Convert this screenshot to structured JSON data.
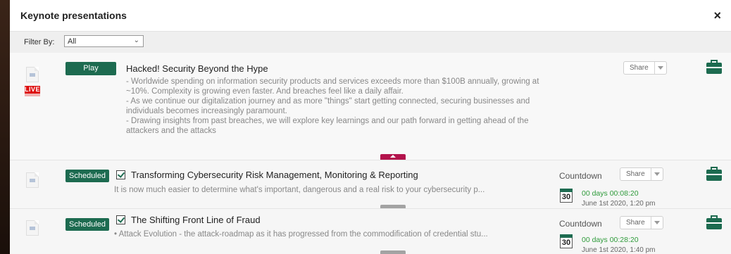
{
  "header": {
    "title": "Keynote presentations",
    "close_label": "×"
  },
  "filter": {
    "label": "Filter By:",
    "value": "All"
  },
  "rows": [
    {
      "status_label": "Play",
      "live_badge": "LIVE",
      "title": "Hacked! Security Beyond the Hype",
      "description": "- Worldwide spending on information security products and services exceeds more than $100B annually, growing at ~10%. Complexity is growing even faster. And breaches feel like a daily affair.\n- As we continue our digitalization journey and as more \"things\" start getting connected, securing businesses and individuals becomes increasingly paramount.\n- Drawing insights from past breaches, we will explore key learnings and our path forward in getting ahead of the attackers and the attacks",
      "share_label": "Share"
    },
    {
      "status_label": "Scheduled",
      "title": "Transforming Cybersecurity Risk Management, Monitoring & Reporting",
      "description": "It is now much easier to determine what's important, dangerous and a real risk to your cybersecurity p...",
      "share_label": "Share",
      "countdown_label": "Countdown",
      "calendar_day": "30",
      "days_text": "00 days",
      "time_text": "00:08:20",
      "date_text": "June 1st 2020, 1:20 pm"
    },
    {
      "status_label": "Scheduled",
      "title": "The Shifting Front Line of Fraud",
      "description": "• Attack Evolution - the attack-roadmap as it has progressed from the commodification of credential stu...",
      "share_label": "Share",
      "countdown_label": "Countdown",
      "calendar_day": "30",
      "days_text": "00 days",
      "time_text": "00:28:20",
      "date_text": "June 1st 2020, 1:40 pm"
    }
  ],
  "colors": {
    "accent_green": "#1d6b50",
    "live_red": "#dd1111",
    "countdown_green": "#2e9a3a",
    "expand_tab": "#b3134c"
  },
  "icons": {
    "file": "file-icon",
    "briefcase": "briefcase-icon",
    "calendar": "calendar-icon",
    "checkbox": "checkbox-checked-icon"
  }
}
